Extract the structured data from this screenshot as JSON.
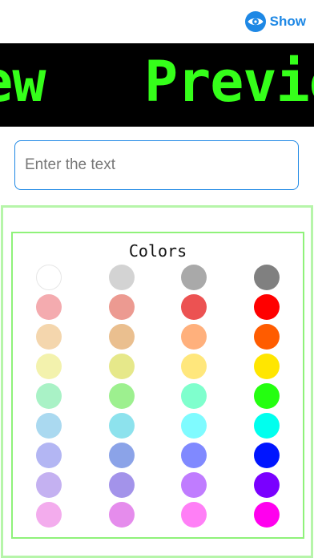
{
  "header": {
    "show_label": "Show",
    "show_icon": "eye-icon",
    "accent_color": "#1e88e5"
  },
  "preview": {
    "text": "view   Preview",
    "text_color": "#35ff1a",
    "background": "#000000"
  },
  "input": {
    "placeholder": "Enter the text",
    "value": ""
  },
  "palette": {
    "title": "Colors",
    "colors": [
      "#ffffff",
      "#d3d3d3",
      "#a9a9a9",
      "#808080",
      "#f4abaf",
      "#ec9a91",
      "#ec5252",
      "#ff0000",
      "#f4d6ad",
      "#eabf8f",
      "#ffb07c",
      "#ff5c00",
      "#f3f2ad",
      "#e6e88a",
      "#ffe77c",
      "#ffe600",
      "#a9f2c6",
      "#9df08f",
      "#7fffcd",
      "#24ff10",
      "#aad9f0",
      "#8de2ed",
      "#7ffbff",
      "#00ffee",
      "#b3b6f3",
      "#8ba3e8",
      "#8089ff",
      "#0015ff",
      "#c4b1f1",
      "#a393ea",
      "#c07cff",
      "#7a00ff",
      "#f3aced",
      "#e58cec",
      "#ff7ff6",
      "#ff00ee"
    ]
  }
}
